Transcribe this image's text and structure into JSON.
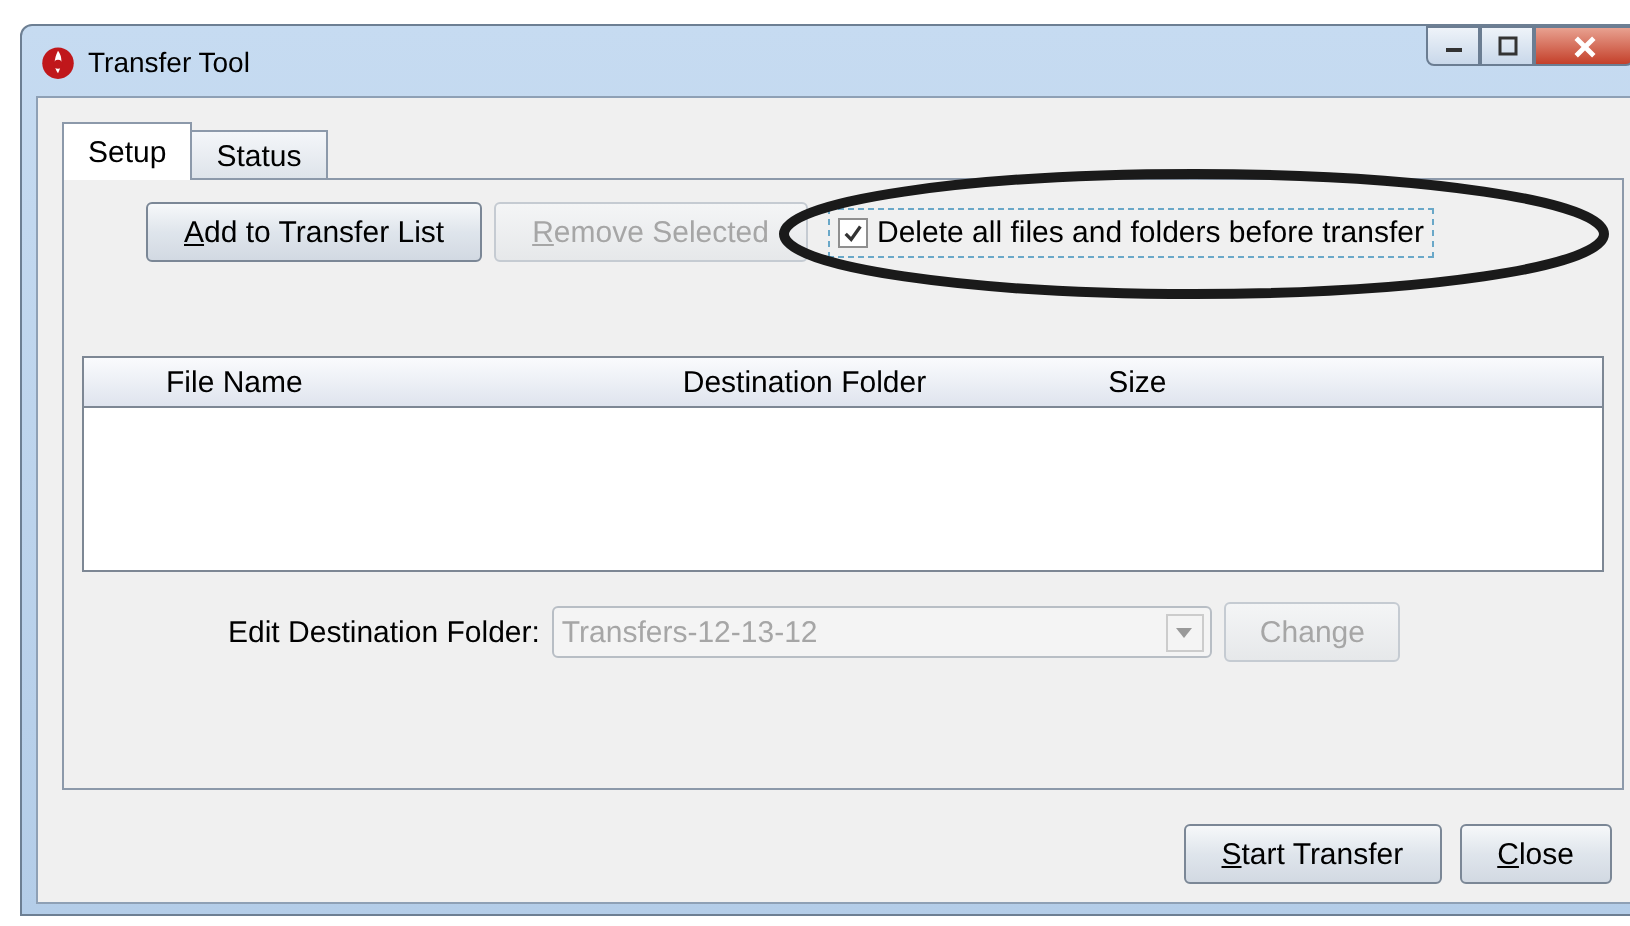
{
  "window": {
    "title": "Transfer Tool"
  },
  "tabs": [
    {
      "label": "Setup",
      "selected": true
    },
    {
      "label": "Status",
      "selected": false
    }
  ],
  "toolbar": {
    "buttons": [
      {
        "label": "Add to Transfer List",
        "disabled": false,
        "mnemonic": true
      },
      {
        "label": "Remove Selected",
        "disabled": true,
        "mnemonic": true
      }
    ],
    "checkbox": {
      "label": "Delete all files and folders before transfer",
      "checked": true,
      "focused": true
    }
  },
  "table": {
    "columns": [
      "File Name",
      "Destination Folder",
      "Size"
    ]
  },
  "destination": {
    "label": "Edit Destination Folder:",
    "value": "Transfers-12-13-12",
    "disabled": true,
    "button": {
      "label": "Change",
      "disabled": true,
      "mnemonic": false
    }
  },
  "buttons": [
    {
      "label": "Start Transfer",
      "disabled": false,
      "mnemonic": true
    },
    {
      "label": "Close",
      "disabled": false,
      "mnemonic": true
    }
  ]
}
